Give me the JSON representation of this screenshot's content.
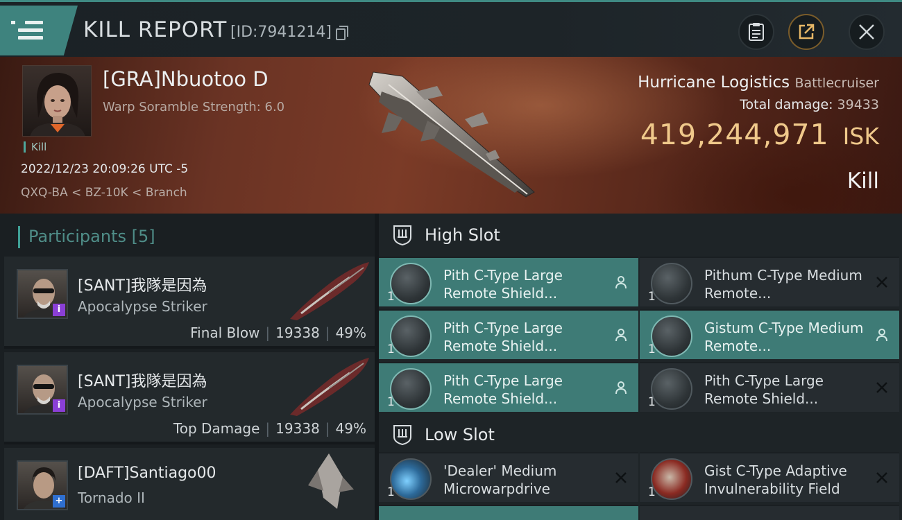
{
  "header": {
    "title": "KILL REPORT",
    "report_id": "[ID:7941214]"
  },
  "victim": {
    "name": "[GRA]Nbuotoo D",
    "scramble": "Warp Soramble Strength: 6.0",
    "kill_tag": "Kill",
    "datetime": "2022/12/23 20:09:26 UTC -5",
    "location": "QXQ-BA < BZ-10K < Branch",
    "ship_name": "Hurricane Logistics",
    "ship_class": "Battlecruiser",
    "total_damage_label": "Total damage:",
    "total_damage": "39433",
    "isk_value": "419,244,971",
    "isk_unit": "ISK",
    "result": "Kill"
  },
  "participants": {
    "label": "Participants [5]",
    "rows": [
      {
        "name": "[SANT]我隊是因為",
        "ship": "Apocalypse Striker",
        "role": "Final Blow",
        "damage": "19338",
        "percent": "49%",
        "badge": "i",
        "badge_color": "#8a3fd6"
      },
      {
        "name": "[SANT]我隊是因為",
        "ship": "Apocalypse Striker",
        "role": "Top Damage",
        "damage": "19338",
        "percent": "49%",
        "badge": "i",
        "badge_color": "#8a3fd6"
      },
      {
        "name": "[DAFT]Santiago00",
        "ship": "Tornado II",
        "role": "",
        "damage": "",
        "percent": "",
        "badge": "+",
        "badge_color": "#2f6fd0"
      }
    ]
  },
  "slots": {
    "high_label": "High Slot",
    "low_label": "Low Slot",
    "high": [
      {
        "name": "Pith C-Type Large Remote Shield...",
        "qty": "1",
        "status": "dropped",
        "icon": "shield-booster-icon"
      },
      {
        "name": "Pithum C-Type Medium Remote...",
        "qty": "1",
        "status": "destroyed",
        "icon": "shield-booster-icon"
      },
      {
        "name": "Pith C-Type Large Remote Shield...",
        "qty": "1",
        "status": "dropped",
        "icon": "shield-booster-icon"
      },
      {
        "name": "Gistum C-Type Medium Remote...",
        "qty": "1",
        "status": "dropped",
        "icon": "shield-booster-icon"
      },
      {
        "name": "Pith C-Type Large Remote Shield...",
        "qty": "1",
        "status": "dropped",
        "icon": "shield-booster-icon"
      },
      {
        "name": "Pith C-Type Large Remote Shield...",
        "qty": "1",
        "status": "destroyed",
        "icon": "shield-booster-icon"
      }
    ],
    "low": [
      {
        "name": "'Dealer' Medium Microwarpdrive",
        "qty": "1",
        "status": "destroyed",
        "icon": "microwarpdrive-icon"
      },
      {
        "name": "Gist C-Type Adaptive Invulnerability Field",
        "qty": "1",
        "status": "destroyed",
        "icon": "invulnerability-field-icon"
      }
    ]
  },
  "colors": {
    "accent": "#3e837e",
    "isk": "#f0c98b",
    "active_module": "#3e7b76"
  }
}
